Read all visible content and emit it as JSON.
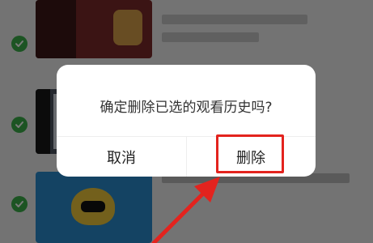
{
  "dialog": {
    "message": "确定删除已选的观看历史吗?",
    "cancel_label": "取消",
    "confirm_label": "删除"
  },
  "colors": {
    "check_green": "#3cb04a",
    "annotation_red": "#e3231e"
  },
  "icons": {
    "selected": "check-circle-icon"
  }
}
